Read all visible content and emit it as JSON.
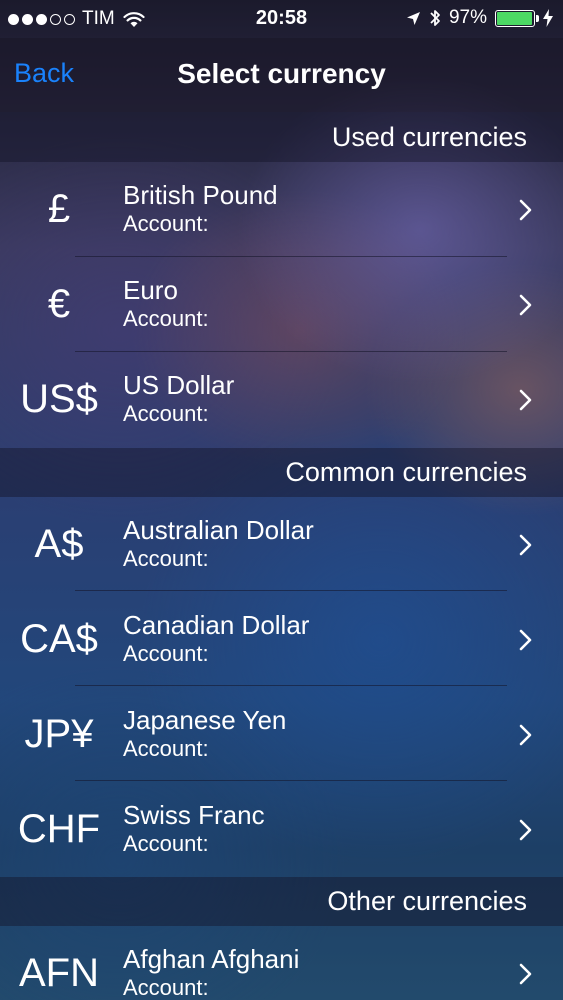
{
  "status_bar": {
    "carrier": "TIM",
    "time": "20:58",
    "battery_percent": "97%",
    "battery_level": 0.97,
    "signal_bars_filled": 3,
    "signal_bars_total": 5
  },
  "nav": {
    "back_label": "Back",
    "title": "Select currency"
  },
  "colors": {
    "accent": "#1a82fb",
    "battery": "#4cd964"
  },
  "sections": [
    {
      "header": "Used currencies",
      "rows": [
        {
          "symbol": "£",
          "name": "British Pound",
          "account": "Account:"
        },
        {
          "symbol": "€",
          "name": "Euro",
          "account": "Account:"
        },
        {
          "symbol": "US$",
          "name": "US Dollar",
          "account": "Account:"
        }
      ]
    },
    {
      "header": "Common currencies",
      "rows": [
        {
          "symbol": "A$",
          "name": "Australian Dollar",
          "account": "Account:"
        },
        {
          "symbol": "CA$",
          "name": "Canadian Dollar",
          "account": "Account:"
        },
        {
          "symbol": "JP¥",
          "name": "Japanese Yen",
          "account": "Account:"
        },
        {
          "symbol": "CHF",
          "name": "Swiss Franc",
          "account": "Account:"
        }
      ]
    },
    {
      "header": "Other currencies",
      "rows": [
        {
          "symbol": "AFN",
          "name": "Afghan Afghani",
          "account": "Account:"
        }
      ]
    }
  ]
}
